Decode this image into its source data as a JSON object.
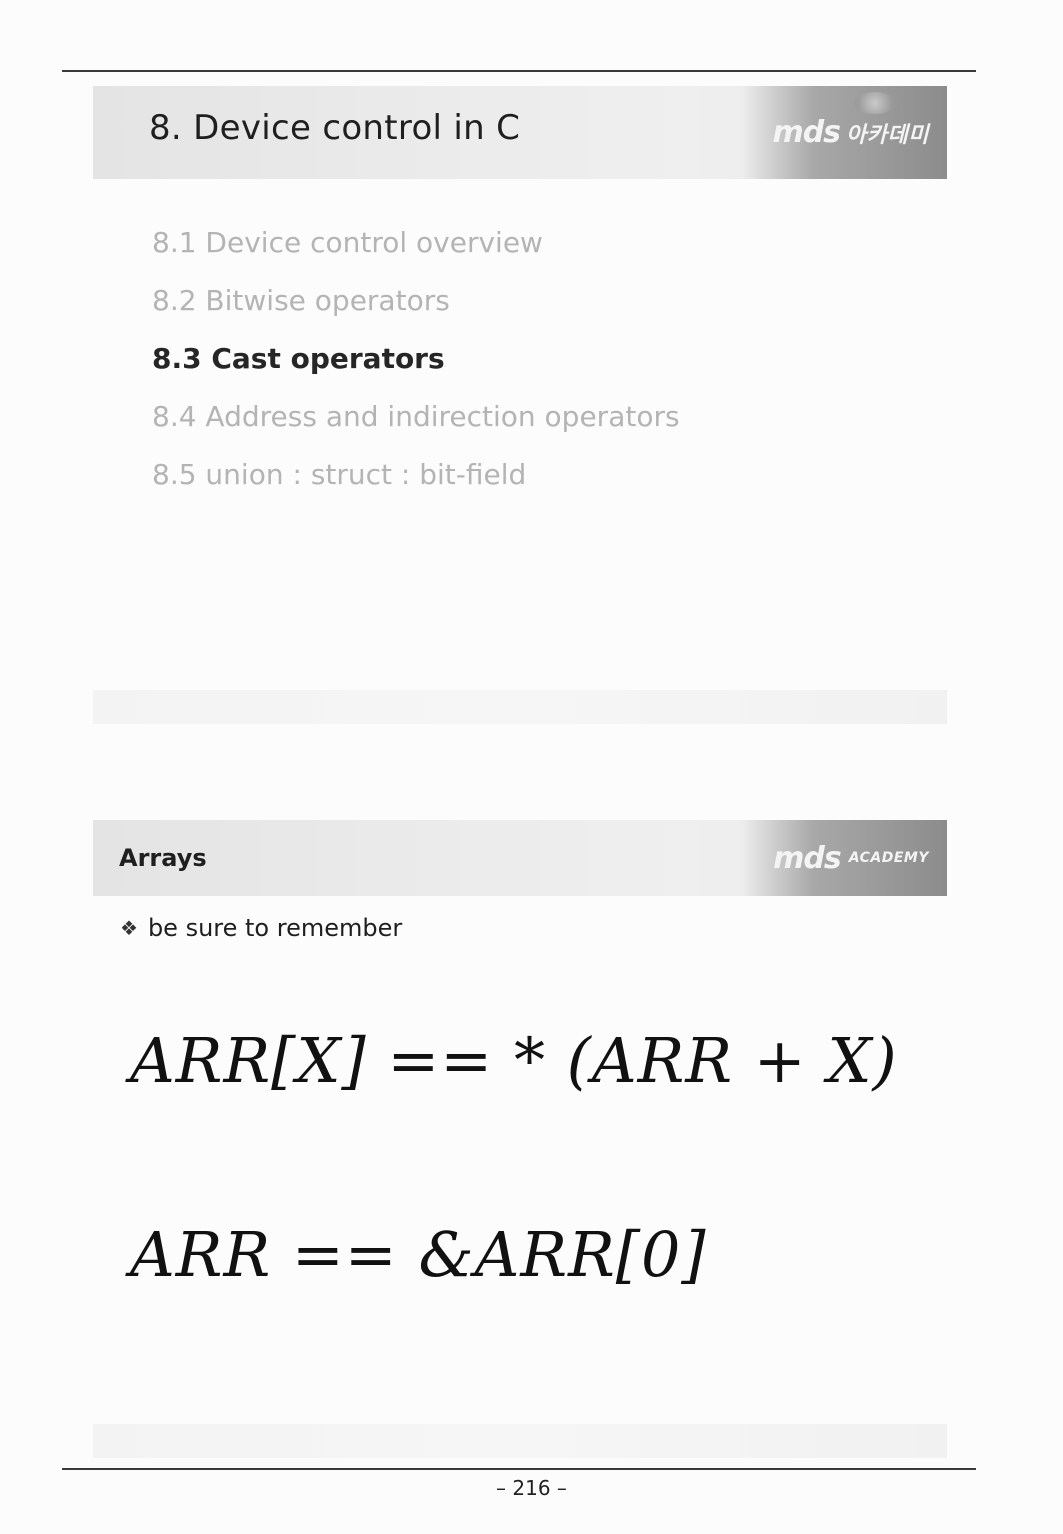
{
  "header": {
    "chapter_title": "8. Device control in C",
    "logo_text": "mds",
    "logo_sub": "아카데미"
  },
  "toc": {
    "items": [
      {
        "label": "8.1 Device control overview",
        "active": false
      },
      {
        "label": "8.2 Bitwise operators",
        "active": false
      },
      {
        "label": "8.3 Cast operators",
        "active": true
      },
      {
        "label": "8.4 Address and indirection operators",
        "active": false
      },
      {
        "label": "8.5 union : struct : bit-field",
        "active": false
      }
    ]
  },
  "section": {
    "title": "Arrays",
    "logo_text": "mds",
    "logo_sub": "ACADEMY"
  },
  "content": {
    "bullet_icon": "❖",
    "bullet_text": "be sure to remember",
    "formula_1": "ARR[X] == * (ARR + X)",
    "formula_2": "ARR == &ARR[0]"
  },
  "footer": {
    "page_number": "– 216 –"
  }
}
